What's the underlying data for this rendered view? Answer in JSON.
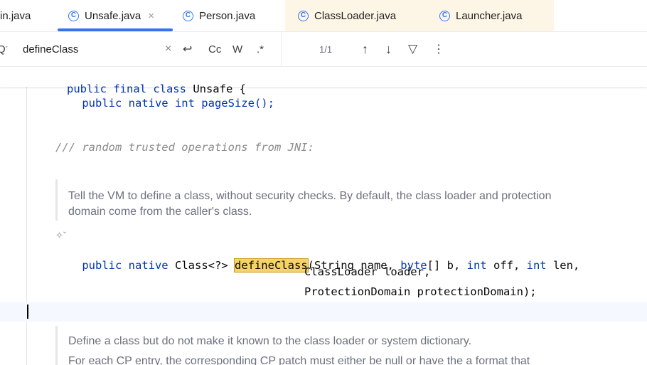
{
  "tabs": [
    {
      "label": "in.java"
    },
    {
      "label": "Unsafe.java",
      "active": true
    },
    {
      "label": "Person.java"
    },
    {
      "label": "ClassLoader.java"
    },
    {
      "label": "Launcher.java"
    }
  ],
  "icons": {
    "class_glyph": "C",
    "close": "×",
    "search": "Q",
    "clear": "×",
    "replace": "↩",
    "up": "↑",
    "down": "↓",
    "filter": "▽",
    "more": "⋮",
    "ai": "✧ˇ"
  },
  "search": {
    "value": "defineClass",
    "match_case_label": "Cc",
    "words_label": "W",
    "regex_label": ".*",
    "match_count": "1/1"
  },
  "code": {
    "sticky_kw": "public final class",
    "sticky_name": " Unsafe {",
    "line_pagesize": "public native int pageSize();",
    "comment": "/// random trusted operations from JNI:",
    "doc1_line1": "Tell the VM to define a class, without security checks. By default, the class loader and protection",
    "doc1_line2": "domain come from the caller's class.",
    "sig_kw": "public native",
    "sig_type": " Class<?> ",
    "sig_method": "defineClass",
    "sig_paren": "(String name, ",
    "sig_byte": "byte",
    "sig_b": "[] b, ",
    "sig_int1": "int",
    "sig_off": " off, ",
    "sig_int2": "int",
    "sig_len": " len,",
    "sig_line2": "ClassLoader loader,",
    "sig_line3": "ProtectionDomain protectionDomain);",
    "doc2_line1": "Define a class but do not make it known to the class loader or system dictionary.",
    "doc2_line2": "For each CP entry, the corresponding CP patch must either be null or have the a format that"
  },
  "colors": {
    "accent": "#3574f0",
    "keyword": "#0033b3",
    "highlight": "#f5d36b"
  }
}
